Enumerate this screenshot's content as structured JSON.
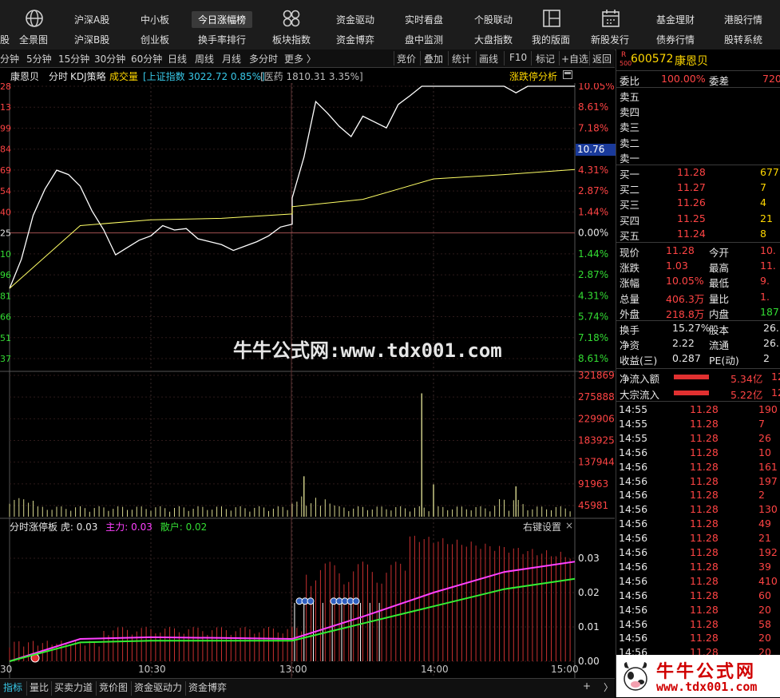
{
  "toolbar": {
    "icons": [
      "globe-icon",
      "grid-icon",
      "chart-icon",
      "calendar-icon"
    ],
    "row1": [
      "沪深A股",
      "中小板",
      "今日涨幅榜",
      "资金驱动",
      "实时看盘",
      "个股联动",
      "基金理财",
      "港股行情"
    ],
    "row2": [
      "股",
      "全景图",
      "沪深B股",
      "创业板",
      "换手率排行",
      "板块指数",
      "资金博弈",
      "盘中监测",
      "大盘指数",
      "我的版面",
      "新股发行",
      "债券行情",
      "股转系统"
    ]
  },
  "periodbar": {
    "periods": [
      "分钟",
      "5分钟",
      "15分钟",
      "30分钟",
      "60分钟",
      "日线",
      "周线",
      "月线",
      "多分时",
      "更多 〉"
    ],
    "actions": [
      "竞价",
      "叠加",
      "统计",
      "画线",
      "F10",
      "标记",
      "+自选",
      "返回"
    ]
  },
  "chart_header": {
    "stock": "康恩贝",
    "mode": "分时",
    "strategy": "KDJ策略",
    "volume_label": "成交量",
    "index1_label": "[上证指数 3022.72 0.85%]",
    "index2_label": "[医药 1810.31 3.35%]",
    "analysis_button": "涨跌停分析"
  },
  "chart_data": [
    {
      "type": "line",
      "series": [
        {
          "name": "康恩贝",
          "color": "#ffffff",
          "x": [
            "09:30",
            "09:35",
            "09:40",
            "09:45",
            "09:50",
            "09:55",
            "10:00",
            "10:05",
            "10:10",
            "10:15",
            "10:20",
            "10:25",
            "10:30",
            "10:35",
            "10:40",
            "10:45",
            "10:50",
            "10:55",
            "11:00",
            "11:05",
            "11:10",
            "11:15",
            "11:20",
            "11:25",
            "11:30",
            "13:00",
            "13:05",
            "13:10",
            "13:15",
            "13:20",
            "13:25",
            "13:30",
            "13:35",
            "13:40",
            "13:45",
            "13:50",
            "13:55",
            "14:00",
            "14:05",
            "14:10",
            "14:15",
            "14:20",
            "14:25",
            "14:30",
            "14:35",
            "14:40",
            "14:45",
            "14:50",
            "14:55",
            "15:00"
          ],
          "values": [
            -3.8,
            -1.8,
            1.2,
            3.0,
            4.3,
            4.0,
            3.2,
            1.5,
            0.2,
            -1.5,
            -1.0,
            -0.5,
            -0.2,
            0.5,
            0.2,
            0.3,
            -0.4,
            -0.6,
            -0.8,
            -1.2,
            -0.9,
            -0.6,
            -0.2,
            0.4,
            0.6,
            2.4,
            5.2,
            9.0,
            8.2,
            7.3,
            6.6,
            8.0,
            7.6,
            7.2,
            8.8,
            9.4,
            10.05,
            10.05,
            10.05,
            10.05,
            10.05,
            10.05,
            10.05,
            10.05,
            9.6,
            10.05,
            10.05,
            10.05,
            10.05,
            10.05
          ]
        },
        {
          "name": "均价",
          "color": "#ffff66",
          "x": [
            "09:30",
            "10:00",
            "10:30",
            "11:00",
            "11:30",
            "13:00",
            "13:30",
            "14:00",
            "14:30",
            "15:00"
          ],
          "values": [
            -3.8,
            0.5,
            0.9,
            1.0,
            1.3,
            1.8,
            2.3,
            3.7,
            4.0,
            4.35
          ]
        }
      ],
      "y_left_ticks": [
        "28",
        "13",
        "99",
        "84",
        "69",
        "54",
        "40",
        "25",
        "10",
        "96",
        "81",
        "66",
        "51",
        "37"
      ],
      "y_right_ticks": [
        "10.05%",
        "8.61%",
        "7.18%",
        "5.74%",
        "4.31%",
        "2.87%",
        "1.44%",
        "0.00%",
        "1.44%",
        "2.87%",
        "4.31%",
        "5.74%",
        "7.18%",
        "8.61%"
      ],
      "current_price_label": "10.76",
      "ylim": [
        -8.61,
        10.05
      ]
    },
    {
      "type": "bar",
      "title": "成交量",
      "y_ticks": [
        "321869",
        "275888",
        "229906",
        "183925",
        "137944",
        "91963",
        "45981"
      ],
      "spikes": [
        {
          "x": "13:05",
          "v": 100000
        },
        {
          "x": "13:55",
          "v": 305000
        },
        {
          "x": "14:00",
          "v": 80000
        },
        {
          "x": "14:35",
          "v": 75000
        }
      ]
    },
    {
      "type": "bar",
      "title": "分时涨停板",
      "legend": {
        "name": "分时涨停板",
        "tiger_label": "虎:",
        "tiger_value": "0.03",
        "main_label": "主力:",
        "main_value": "0.03",
        "retail_label": "散户:",
        "retail_value": "0.02",
        "settings": "右键设置",
        "close": "×"
      },
      "y_ticks": [
        "0.03",
        "0.02",
        "0.01",
        "0.00"
      ],
      "x_ticks": [
        "30",
        "10:30",
        "13:00",
        "14:00",
        "15:00"
      ],
      "main_force": {
        "name": "主力",
        "color": "#ff40ff",
        "x": [
          "09:30",
          "10:00",
          "10:30",
          "11:00",
          "11:30",
          "13:00",
          "13:30",
          "14:00",
          "14:30",
          "15:00"
        ],
        "values": [
          0.0,
          0.0065,
          0.007,
          0.0068,
          0.0065,
          0.0065,
          0.013,
          0.02,
          0.026,
          0.029
        ]
      },
      "retail": {
        "name": "散户",
        "color": "#33ee33",
        "x": [
          "09:30",
          "10:00",
          "10:30",
          "11:00",
          "11:30",
          "13:00",
          "13:30",
          "14:00",
          "14:30",
          "15:00"
        ],
        "values": [
          0.0,
          0.0055,
          0.006,
          0.006,
          0.006,
          0.006,
          0.011,
          0.016,
          0.021,
          0.024
        ]
      }
    }
  ],
  "watermark": "牛牛公式网:www.tdx001.com",
  "rightpanel": {
    "code": "600572",
    "name": "康恩贝",
    "badge_r": "R",
    "badge_n": "500",
    "weibi_label": "委比",
    "weibi_value": "100.00%",
    "weicha_label": "委差",
    "weicha_value": "720",
    "sell": [
      {
        "label": "卖五"
      },
      {
        "label": "卖四"
      },
      {
        "label": "卖三"
      },
      {
        "label": "卖二"
      },
      {
        "label": "卖一"
      }
    ],
    "buy": [
      {
        "label": "买一",
        "price": "11.28",
        "vol": "677"
      },
      {
        "label": "买二",
        "price": "11.27",
        "vol": "7"
      },
      {
        "label": "买三",
        "price": "11.26",
        "vol": "4"
      },
      {
        "label": "买四",
        "price": "11.25",
        "vol": "21"
      },
      {
        "label": "买五",
        "price": "11.24",
        "vol": "8"
      }
    ],
    "stats": [
      {
        "l1": "现价",
        "v1": "11.28",
        "l2": "今开",
        "v2": "10."
      },
      {
        "l1": "涨跌",
        "v1": "1.03",
        "l2": "最高",
        "v2": "11."
      },
      {
        "l1": "涨幅",
        "v1": "10.05%",
        "l2": "最低",
        "v2": "9."
      },
      {
        "l1": "总量",
        "v1": "406.3万",
        "l2": "量比",
        "v2": "1."
      },
      {
        "l1": "外盘",
        "v1": "218.8万",
        "l2": "内盘",
        "v2": "187.5"
      }
    ],
    "stats2": [
      {
        "l1": "换手",
        "v1": "15.27%",
        "l2": "股本",
        "v2": "26."
      },
      {
        "l1": "净资",
        "v1": "2.22",
        "l2": "流通",
        "v2": "26."
      },
      {
        "l1": "收益(三)",
        "v1": "0.287",
        "l2": "PE(动)",
        "v2": "2"
      }
    ],
    "flows": [
      {
        "label": "净流入额",
        "value": "5.34亿",
        "extra": "12"
      },
      {
        "label": "大宗流入",
        "value": "5.22亿",
        "extra": "12"
      }
    ],
    "ticks": [
      {
        "t": "14:55",
        "p": "11.28",
        "v": "190"
      },
      {
        "t": "14:55",
        "p": "11.28",
        "v": "7"
      },
      {
        "t": "14:55",
        "p": "11.28",
        "v": "26"
      },
      {
        "t": "14:56",
        "p": "11.28",
        "v": "10"
      },
      {
        "t": "14:56",
        "p": "11.28",
        "v": "161"
      },
      {
        "t": "14:56",
        "p": "11.28",
        "v": "197"
      },
      {
        "t": "14:56",
        "p": "11.28",
        "v": "2"
      },
      {
        "t": "14:56",
        "p": "11.28",
        "v": "130"
      },
      {
        "t": "14:56",
        "p": "11.28",
        "v": "49"
      },
      {
        "t": "14:56",
        "p": "11.28",
        "v": "21"
      },
      {
        "t": "14:56",
        "p": "11.28",
        "v": "192"
      },
      {
        "t": "14:56",
        "p": "11.28",
        "v": "39"
      },
      {
        "t": "14:56",
        "p": "11.28",
        "v": "410"
      },
      {
        "t": "14:56",
        "p": "11.28",
        "v": "60"
      },
      {
        "t": "14:56",
        "p": "11.28",
        "v": "20"
      },
      {
        "t": "14:56",
        "p": "11.28",
        "v": "58"
      },
      {
        "t": "14:56",
        "p": "11.28",
        "v": "20"
      },
      {
        "t": "14:56",
        "p": "11.28",
        "v": "20"
      }
    ],
    "logo_text": "牛牛公式网",
    "logo_url": "www.tdx001.com"
  },
  "bottomtabs": {
    "tabs": [
      "指标",
      "量比",
      "买卖力道",
      "竞价图",
      "资金驱动力",
      "资金博弈"
    ],
    "plus": "+",
    "more": "〉"
  },
  "colors": {
    "up": "#ff4444",
    "down": "#33dd33",
    "price": "#ffffff",
    "avg": "#ffff66",
    "accent": "#1a3a9a"
  }
}
